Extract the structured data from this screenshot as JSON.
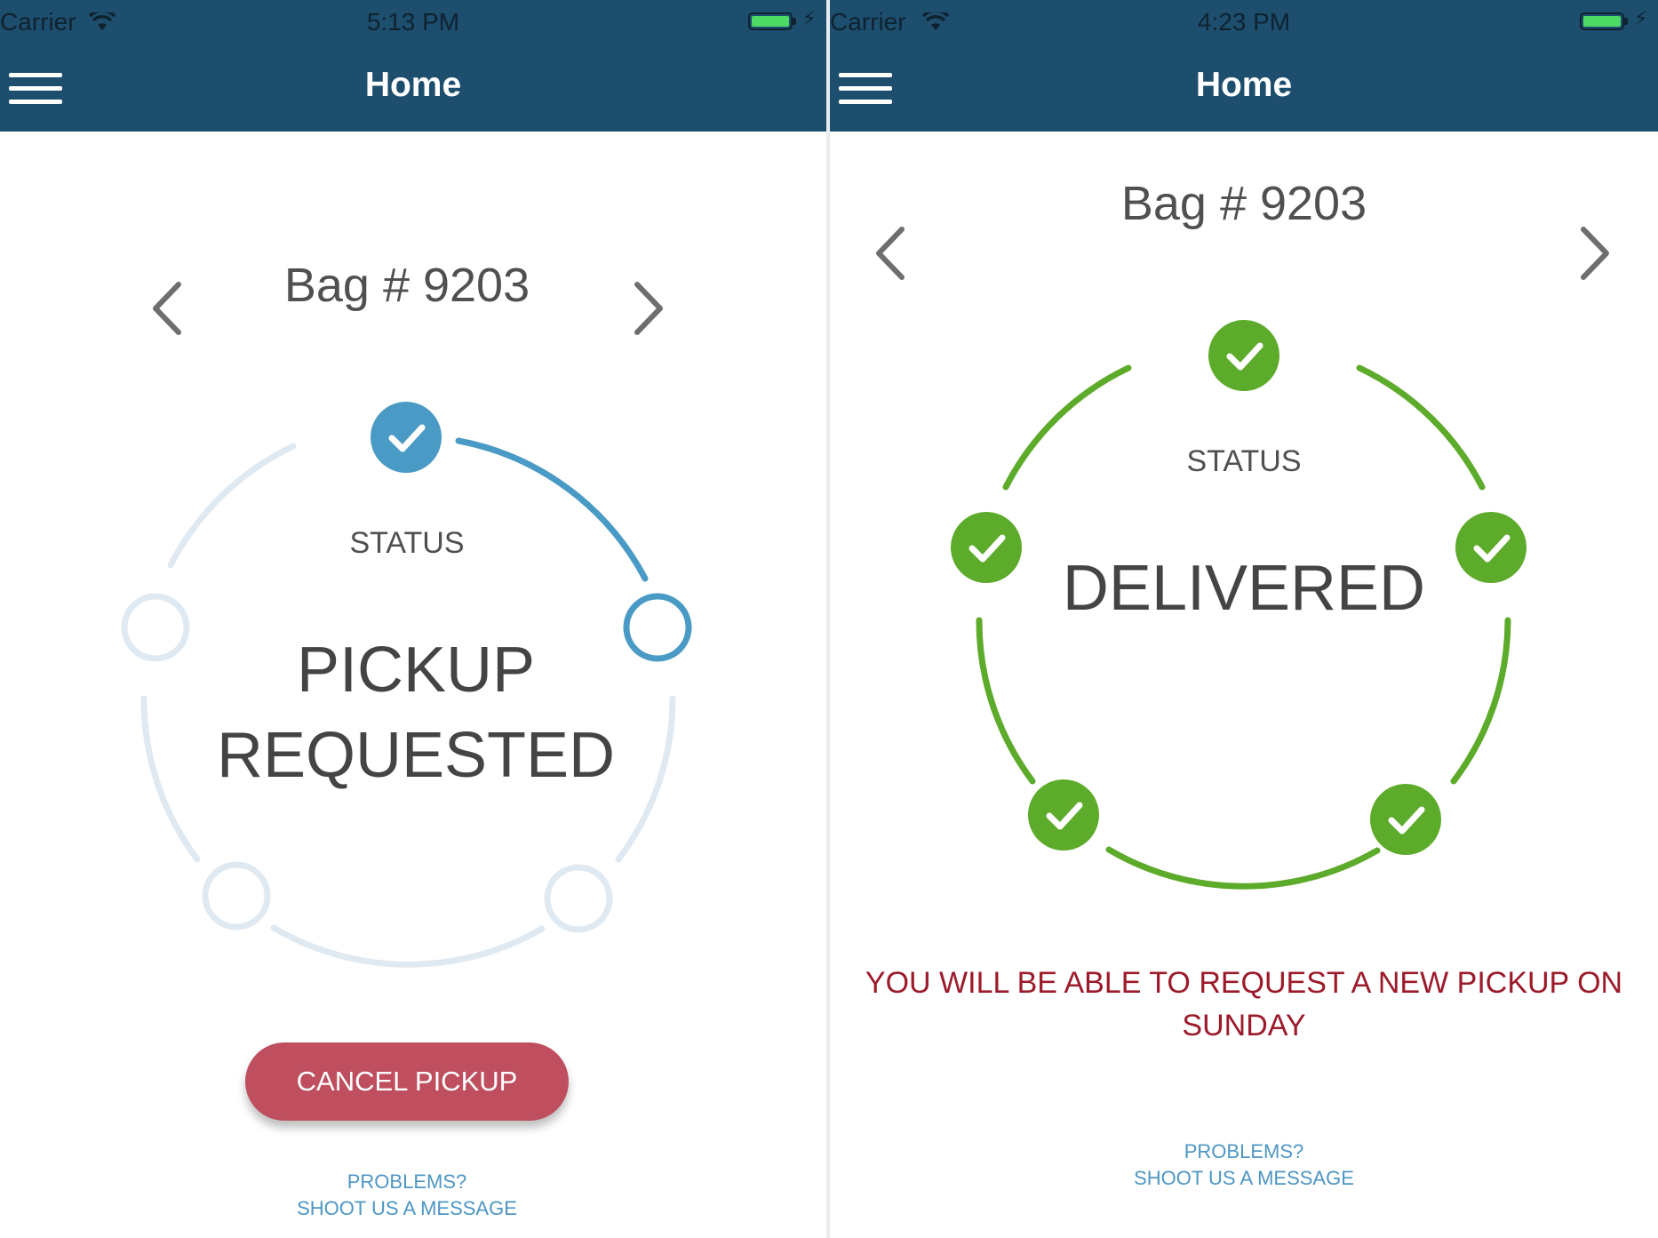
{
  "colors": {
    "header": "#1d4e6e",
    "progress_blue": "#4a9ac6",
    "progress_light": "#dfe9f2",
    "delivered_green": "#5dab2a",
    "cancel_red": "#bf4f5e",
    "notice_red": "#9c1a2a",
    "link_blue": "#4d96c4"
  },
  "left_screen": {
    "status_bar": {
      "carrier": "Carrier",
      "time": "5:13 PM",
      "battery_icon": "battery-charging-icon"
    },
    "header": {
      "title": "Home",
      "menu_icon": "hamburger-menu-icon"
    },
    "bag_title": "Bag # 9203",
    "status_label": "STATUS",
    "status_line1": "PICKUP",
    "status_line2": "REQUESTED",
    "progress": {
      "total_steps": 5,
      "completed_steps": 1,
      "current_step": 2
    },
    "cancel_button": "CANCEL PICKUP",
    "problems": "PROBLEMS?",
    "shoot_message": "SHOOT US A MESSAGE"
  },
  "right_screen": {
    "status_bar": {
      "carrier": "Carrier",
      "time": "4:23 PM",
      "battery_icon": "battery-charging-icon"
    },
    "header": {
      "title": "Home",
      "menu_icon": "hamburger-menu-icon"
    },
    "bag_title": "Bag # 9203",
    "status_label": "STATUS",
    "status_value": "DELIVERED",
    "progress": {
      "total_steps": 5,
      "completed_steps": 5
    },
    "notice_line1": "YOU WILL BE ABLE TO REQUEST A NEW PICKUP ON",
    "notice_line2": "SUNDAY",
    "problems": "PROBLEMS?",
    "shoot_message": "SHOOT US A MESSAGE"
  }
}
